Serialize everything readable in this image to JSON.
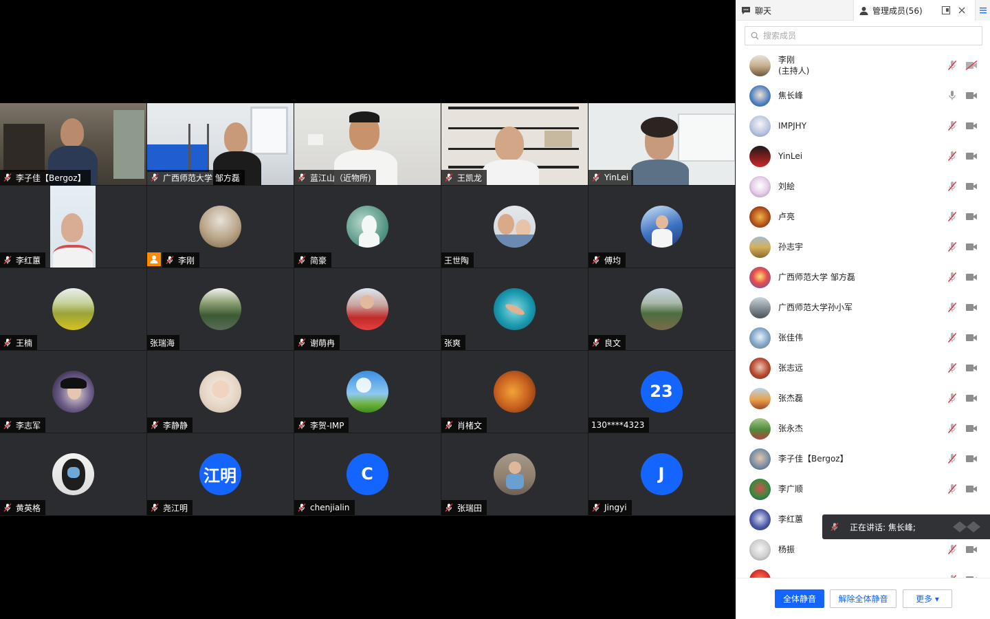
{
  "grid": {
    "tiles": [
      {
        "name": "李子佳【Bergoz】",
        "muted": true
      },
      {
        "name": "广西师范大学 邹方磊",
        "muted": true
      },
      {
        "name": "蓝江山（近物所)",
        "muted": true
      },
      {
        "name": "王凯龙",
        "muted": true
      },
      {
        "name": "YinLei",
        "muted": true
      },
      {
        "name": "李红蕙",
        "muted": true
      },
      {
        "name": "李刚",
        "muted": true,
        "host": true
      },
      {
        "name": "简豪",
        "muted": true
      },
      {
        "name": "王世陶",
        "muted": false
      },
      {
        "name": "傅均",
        "muted": true
      },
      {
        "name": "王楠",
        "muted": true
      },
      {
        "name": "张瑞海",
        "muted": false
      },
      {
        "name": "谢萌冉",
        "muted": true
      },
      {
        "name": "张爽",
        "muted": false
      },
      {
        "name": "良文",
        "muted": true
      },
      {
        "name": "李志军",
        "muted": true
      },
      {
        "name": "李静静",
        "muted": true
      },
      {
        "name": "李贺-IMP",
        "muted": true
      },
      {
        "name": "肖楮文",
        "muted": true
      },
      {
        "name": "130****4323",
        "muted": false,
        "avatar_text": "23"
      },
      {
        "name": "黄英格",
        "muted": true
      },
      {
        "name": "尧江明",
        "muted": true,
        "avatar_text": "江明"
      },
      {
        "name": "chenjialin",
        "muted": true,
        "avatar_text": "C"
      },
      {
        "name": "张瑞田",
        "muted": true
      },
      {
        "name": "Jingyi",
        "muted": true,
        "avatar_text": "J"
      }
    ]
  },
  "panel": {
    "tab_chat": "聊天",
    "tab_members": "管理成员(56)",
    "search_placeholder": "搜索成员",
    "members": [
      {
        "name": "李刚",
        "sub": "(主持人)",
        "mic": "muted",
        "cam": "off"
      },
      {
        "name": "焦长峰",
        "mic": "on",
        "cam": "on"
      },
      {
        "name": "IMPJHY",
        "mic": "muted",
        "cam": "on"
      },
      {
        "name": "YinLei",
        "mic": "muted",
        "cam": "on"
      },
      {
        "name": "刘絵",
        "mic": "muted",
        "cam": "on"
      },
      {
        "name": "卢亮",
        "mic": "muted",
        "cam": "on"
      },
      {
        "name": "孙志宇",
        "mic": "muted",
        "cam": "on"
      },
      {
        "name": "广西师范大学 邹方磊",
        "mic": "muted",
        "cam": "on"
      },
      {
        "name": "广西师范大学孙小军",
        "mic": "muted",
        "cam": "on"
      },
      {
        "name": "张佳伟",
        "mic": "muted",
        "cam": "on"
      },
      {
        "name": "张志远",
        "mic": "muted",
        "cam": "on"
      },
      {
        "name": "张杰磊",
        "mic": "muted",
        "cam": "on"
      },
      {
        "name": "张永杰",
        "mic": "muted",
        "cam": "on"
      },
      {
        "name": "李子佳【Bergoz】",
        "mic": "muted",
        "cam": "on"
      },
      {
        "name": "李广顺",
        "mic": "muted",
        "cam": "on"
      },
      {
        "name": "李红蕙",
        "mic": "muted",
        "cam": "on"
      },
      {
        "name": "杨振",
        "mic": "muted",
        "cam": "on"
      },
      {
        "name": "",
        "mic": "muted",
        "cam": "on"
      }
    ],
    "btn_mute_all": "全体静音",
    "btn_unmute_all": "解除全体静音",
    "btn_more": "更多 ▾"
  },
  "toast": {
    "text": "正在讲话: 焦长峰;"
  },
  "colors": {
    "accent": "#1465ff",
    "tile_bg": "#2b2c30",
    "muted_red": "#e0303a",
    "host_badge": "#ff8a00"
  }
}
